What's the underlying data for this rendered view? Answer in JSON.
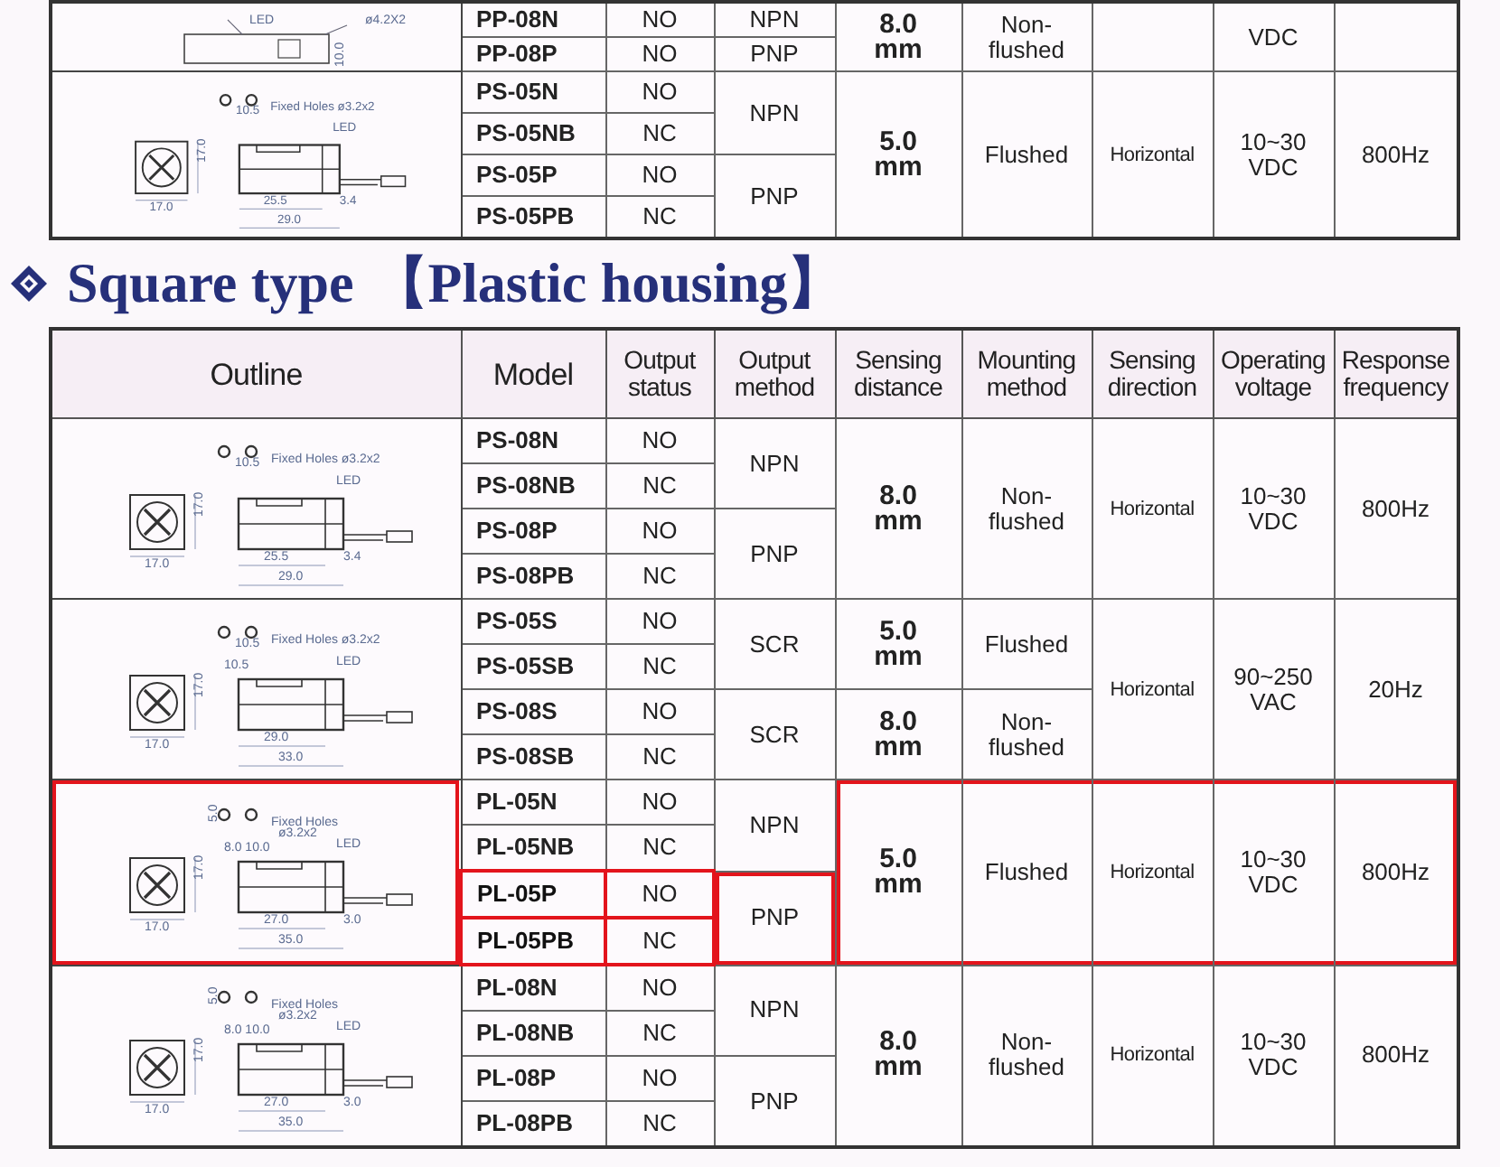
{
  "tables": [
    {
      "groups": [
        {
          "outline": {
            "kind": "partial",
            "labels": [
              {
                "kind": "led",
                "text": "LED"
              },
              {
                "kind": "cable",
                "text": "ø4.2X2"
              },
              {
                "kind": "side",
                "text": "10.0"
              }
            ],
            "highlighted": false
          },
          "rows": [
            {
              "model": "PP-08N",
              "status": "NO",
              "highlighted": false
            },
            {
              "model": "PP-08P",
              "status": "NO",
              "highlighted": false
            }
          ],
          "method": [
            {
              "text": "NPN",
              "highlighted": false
            },
            {
              "text": "PNP",
              "highlighted": false
            }
          ],
          "specs": {
            "highlighted": false,
            "distance": [
              "8.0\nmm"
            ],
            "mounting": [
              "Non-\nflushed"
            ],
            "voltage": [
              "VDC"
            ]
          }
        },
        {
          "outline": {
            "kind": "square",
            "labels": [
              {
                "kind": "spacing",
                "text": "10.5"
              },
              {
                "kind": "holes",
                "text": "Fixed Holes ø3.2x2"
              },
              {
                "kind": "led",
                "text": "LED"
              },
              {
                "kind": "height",
                "text": "17.0"
              },
              {
                "kind": "width",
                "text": "17.0"
              },
              {
                "kind": "body",
                "text": "25.5"
              },
              {
                "kind": "tail",
                "text": "3.4"
              },
              {
                "kind": "total",
                "text": "29.0"
              }
            ],
            "highlighted": false
          },
          "rows": [
            {
              "model": "PS-05N",
              "status": "NO",
              "highlighted": false
            },
            {
              "model": "PS-05NB",
              "status": "NC",
              "highlighted": false
            },
            {
              "model": "PS-05P",
              "status": "NO",
              "highlighted": false
            },
            {
              "model": "PS-05PB",
              "status": "NC",
              "highlighted": false
            }
          ],
          "method": [
            {
              "text": "NPN",
              "highlighted": false
            },
            {
              "text": "PNP",
              "highlighted": false
            }
          ],
          "specs": {
            "highlighted": false,
            "distance": [
              "5.0\nmm"
            ],
            "mounting": [
              "Flushed"
            ],
            "direction": [
              "Horizontal"
            ],
            "voltage": [
              "10~30\nVDC"
            ],
            "frequency": [
              "800Hz"
            ]
          }
        }
      ]
    },
    {
      "title": {
        "main": "Square type",
        "sub": "【Plastic housing】"
      },
      "header": [
        "Outline",
        "Model",
        "Output\nstatus",
        "Output\nmethod",
        "Sensing\ndistance",
        "Mounting\nmethod",
        "Sensing\ndirection",
        "Operating\nvoltage",
        "Response\nfrequency"
      ],
      "groups": [
        {
          "outline": {
            "kind": "square",
            "labels": [
              {
                "kind": "spacing",
                "text": "10.5"
              },
              {
                "kind": "holes",
                "text": "Fixed Holes ø3.2x2"
              },
              {
                "kind": "led",
                "text": "LED"
              },
              {
                "kind": "height",
                "text": "17.0"
              },
              {
                "kind": "width",
                "text": "17.0"
              },
              {
                "kind": "body",
                "text": "25.5"
              },
              {
                "kind": "tail",
                "text": "3.4"
              },
              {
                "kind": "total",
                "text": "29.0"
              }
            ],
            "highlighted": false
          },
          "rows": [
            {
              "model": "PS-08N",
              "status": "NO",
              "highlighted": false
            },
            {
              "model": "PS-08NB",
              "status": "NC",
              "highlighted": false
            },
            {
              "model": "PS-08P",
              "status": "NO",
              "highlighted": false
            },
            {
              "model": "PS-08PB",
              "status": "NC",
              "highlighted": false
            }
          ],
          "method": [
            {
              "text": "NPN",
              "highlighted": false
            },
            {
              "text": "PNP",
              "highlighted": false
            }
          ],
          "specs": {
            "highlighted": false,
            "distance": [
              "8.0\nmm"
            ],
            "mounting": [
              "Non-\nflushed"
            ],
            "direction": [
              "Horizontal"
            ],
            "voltage": [
              "10~30\nVDC"
            ],
            "frequency": [
              "800Hz"
            ]
          }
        },
        {
          "outline": {
            "kind": "square",
            "labels": [
              {
                "kind": "spacing",
                "text": "10.5"
              },
              {
                "kind": "holes",
                "text": "Fixed Holes ø3.2x2"
              },
              {
                "kind": "offset",
                "text": "10.5"
              },
              {
                "kind": "led",
                "text": "LED"
              },
              {
                "kind": "height",
                "text": "17.0"
              },
              {
                "kind": "width",
                "text": "17.0"
              },
              {
                "kind": "body",
                "text": "29.0"
              },
              {
                "kind": "total",
                "text": "33.0"
              }
            ],
            "highlighted": false
          },
          "rows": [
            {
              "model": "PS-05S",
              "status": "NO",
              "highlighted": false
            },
            {
              "model": "PS-05SB",
              "status": "NC",
              "highlighted": false
            },
            {
              "model": "PS-08S",
              "status": "NO",
              "highlighted": false
            },
            {
              "model": "PS-08SB",
              "status": "NC",
              "highlighted": false
            }
          ],
          "method": [
            {
              "text": "SCR",
              "highlighted": false
            },
            {
              "text": "SCR",
              "highlighted": false
            }
          ],
          "specs": {
            "highlighted": false,
            "distance": [
              "5.0\nmm",
              "8.0\nmm"
            ],
            "mounting": [
              "Flushed",
              "Non-\nflushed"
            ],
            "direction": [
              "Horizontal"
            ],
            "voltage": [
              "90~250\nVAC"
            ],
            "frequency": [
              "20Hz"
            ]
          }
        },
        {
          "outline": {
            "kind": "square",
            "labels": [
              {
                "kind": "pitch",
                "text": "5.0"
              },
              {
                "kind": "holes",
                "text": "Fixed Holes"
              },
              {
                "kind": "holes2",
                "text": "ø3.2x2"
              },
              {
                "kind": "offset",
                "text": "8.0 10.0"
              },
              {
                "kind": "led",
                "text": "LED"
              },
              {
                "kind": "height",
                "text": "17.0"
              },
              {
                "kind": "width",
                "text": "17.0"
              },
              {
                "kind": "body",
                "text": "27.0"
              },
              {
                "kind": "tail",
                "text": "3.0"
              },
              {
                "kind": "total",
                "text": "35.0"
              }
            ],
            "highlighted": true
          },
          "rows": [
            {
              "model": "PL-05N",
              "status": "NO",
              "highlighted": false
            },
            {
              "model": "PL-05NB",
              "status": "NC",
              "highlighted": false
            },
            {
              "model": "PL-05P",
              "status": "NO",
              "highlighted": true
            },
            {
              "model": "PL-05PB",
              "status": "NC",
              "highlighted": true
            }
          ],
          "method": [
            {
              "text": "NPN",
              "highlighted": false
            },
            {
              "text": "PNP",
              "highlighted": true
            }
          ],
          "specs": {
            "highlighted": true,
            "distance": [
              "5.0\nmm"
            ],
            "mounting": [
              "Flushed"
            ],
            "direction": [
              "Horizontal"
            ],
            "voltage": [
              "10~30\nVDC"
            ],
            "frequency": [
              "800Hz"
            ]
          }
        },
        {
          "outline": {
            "kind": "square",
            "labels": [
              {
                "kind": "pitch",
                "text": "5.0"
              },
              {
                "kind": "holes",
                "text": "Fixed Holes"
              },
              {
                "kind": "holes2",
                "text": "ø3.2x2"
              },
              {
                "kind": "offset",
                "text": "8.0 10.0"
              },
              {
                "kind": "led",
                "text": "LED"
              },
              {
                "kind": "height",
                "text": "17.0"
              },
              {
                "kind": "width",
                "text": "17.0"
              },
              {
                "kind": "body",
                "text": "27.0"
              },
              {
                "kind": "tail",
                "text": "3.0"
              },
              {
                "kind": "total",
                "text": "35.0"
              }
            ],
            "highlighted": false
          },
          "rows": [
            {
              "model": "PL-08N",
              "status": "NO",
              "highlighted": false
            },
            {
              "model": "PL-08NB",
              "status": "NC",
              "highlighted": false
            },
            {
              "model": "PL-08P",
              "status": "NO",
              "highlighted": false
            },
            {
              "model": "PL-08PB",
              "status": "NC",
              "highlighted": false
            }
          ],
          "method": [
            {
              "text": "NPN",
              "highlighted": false
            },
            {
              "text": "PNP",
              "highlighted": false
            }
          ],
          "specs": {
            "highlighted": false,
            "distance": [
              "8.0\nmm"
            ],
            "mounting": [
              "Non-\nflushed"
            ],
            "direction": [
              "Horizontal"
            ],
            "voltage": [
              "10~30\nVDC"
            ],
            "frequency": [
              "800Hz"
            ]
          }
        }
      ]
    }
  ]
}
